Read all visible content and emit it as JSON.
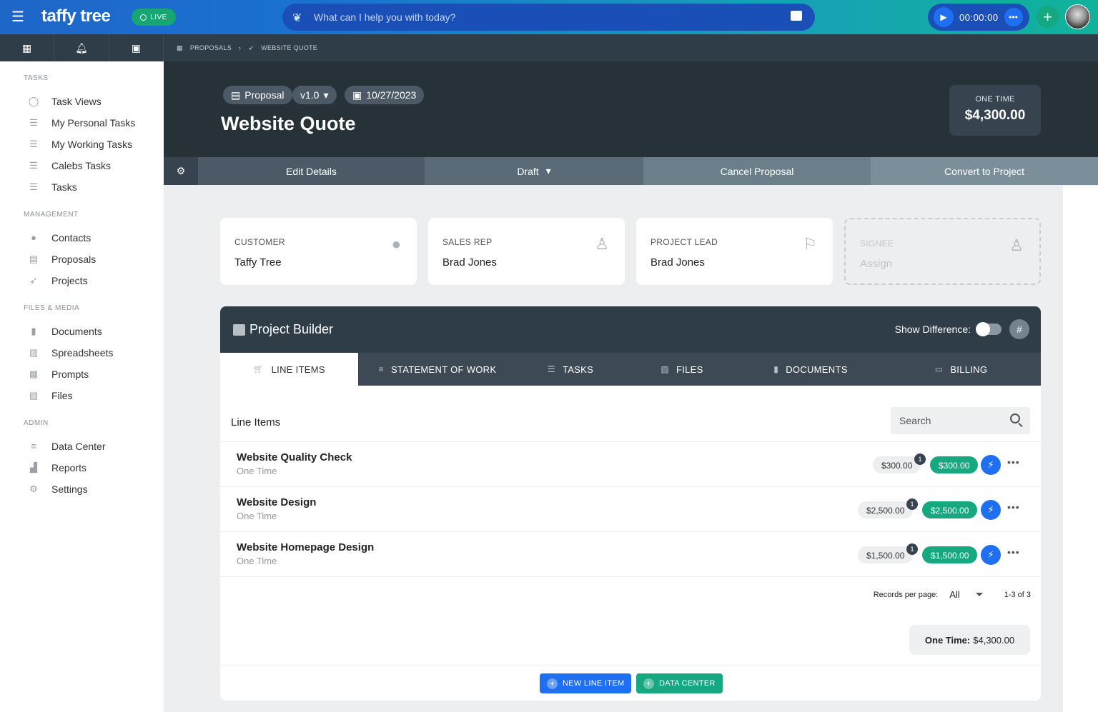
{
  "topbar": {
    "logo": "taffy tree",
    "live_label": "LIVE",
    "ai_placeholder": "What can I help you with today?",
    "timer": "00:00:00",
    "colors": {
      "brand_blue": "#1f66c9",
      "brand_green": "#10b39a"
    }
  },
  "sidebar": {
    "sections": {
      "tasks": "TASKS",
      "management": "MANAGEMENT",
      "files_media": "FILES & MEDIA",
      "admin": "ADMIN"
    },
    "tasks": [
      {
        "label": "Task Views",
        "icon": "check-circle-icon"
      },
      {
        "label": "My Personal Tasks",
        "icon": "checklist-icon"
      },
      {
        "label": "My Working Tasks",
        "icon": "checklist-icon"
      },
      {
        "label": "Calebs Tasks",
        "icon": "checklist-icon"
      },
      {
        "label": "Tasks",
        "icon": "checklist-icon"
      }
    ],
    "management": [
      {
        "label": "Contacts",
        "icon": "person-circle-icon"
      },
      {
        "label": "Proposals",
        "icon": "proposal-icon"
      },
      {
        "label": "Projects",
        "icon": "rocket-icon"
      }
    ],
    "files": [
      {
        "label": "Documents",
        "icon": "document-icon"
      },
      {
        "label": "Spreadsheets",
        "icon": "table-icon"
      },
      {
        "label": "Prompts",
        "icon": "prompt-icon"
      },
      {
        "label": "Files",
        "icon": "image-icon"
      }
    ],
    "admin": [
      {
        "label": "Data Center",
        "icon": "list-icon"
      },
      {
        "label": "Reports",
        "icon": "bar-chart-icon"
      },
      {
        "label": "Settings",
        "icon": "gear-icon"
      }
    ]
  },
  "breadcrumb": {
    "root": "PROPOSALS",
    "current": "WEBSITE QUOTE"
  },
  "header": {
    "type_pill": "Proposal",
    "version": "v1.0",
    "date": "10/27/2023",
    "title": "Website Quote",
    "total_label": "ONE TIME",
    "total_value": "$4,300.00"
  },
  "actions": {
    "edit": "Edit Details",
    "status": "Draft",
    "cancel": "Cancel Proposal",
    "convert": "Convert to Project"
  },
  "cards": [
    {
      "label": "CUSTOMER",
      "value": "Taffy Tree"
    },
    {
      "label": "SALES REP",
      "value": "Brad Jones"
    },
    {
      "label": "PROJECT LEAD",
      "value": "Brad Jones"
    },
    {
      "label": "SIGNEE",
      "value": "Assign"
    }
  ],
  "builder": {
    "title": "Project Builder",
    "show_difference": "Show Difference:",
    "show_difference_on": false,
    "tabs": [
      "LINE ITEMS",
      "STATEMENT OF WORK",
      "TASKS",
      "FILES",
      "DOCUMENTS",
      "BILLING"
    ],
    "active_tab": "LINE ITEMS",
    "section_title": "Line Items",
    "search_placeholder": "Search",
    "items": [
      {
        "name": "Website Quality Check",
        "type": "One Time",
        "amount": "$300.00",
        "count": "1",
        "total": "$300.00"
      },
      {
        "name": "Website Design",
        "type": "One Time",
        "amount": "$2,500.00",
        "count": "1",
        "total": "$2,500.00"
      },
      {
        "name": "Website Homepage Design",
        "type": "One Time",
        "amount": "$1,500.00",
        "count": "1",
        "total": "$1,500.00"
      }
    ],
    "records_label": "Records per page:",
    "records_value": "All",
    "range": "1-3 of 3",
    "total_label": "One Time:",
    "total_value": "$4,300.00",
    "new_line_item": "NEW LINE ITEM",
    "data_center": "DATA CENTER"
  }
}
